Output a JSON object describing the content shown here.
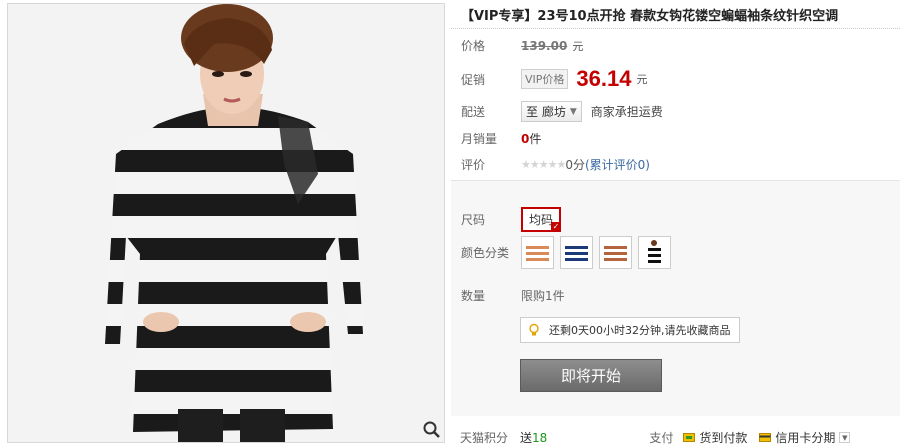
{
  "product": {
    "title": "【VIP专享】23号10点开抢 春款女钩花镂空蝙蝠袖条纹针织空调"
  },
  "price": {
    "label": "价格",
    "original": "139.00",
    "unit": "元"
  },
  "promo": {
    "label": "促销",
    "tag": "VIP价格",
    "price": "36.14",
    "unit": "元"
  },
  "shipping": {
    "label": "配送",
    "destination": "至 廊坊",
    "note": "商家承担运费"
  },
  "monthly_sales": {
    "label": "月销量",
    "count": "0",
    "unit": "件"
  },
  "rating": {
    "label": "评价",
    "stars": "★★★★★",
    "score": "0分",
    "reviews": "(累计评价0)"
  },
  "size": {
    "label": "尺码",
    "selected": "均码"
  },
  "color": {
    "label": "颜色分类",
    "swatches": [
      "orange-stripe",
      "navy-stripe",
      "brown-stripe",
      "black-white-stripe"
    ],
    "colors": [
      "#d98a57",
      "#1d3a78",
      "#b5653e",
      "#111111"
    ]
  },
  "quantity": {
    "label": "数量",
    "limit": "限购1件"
  },
  "notice": {
    "text": "还剩0天00小时32分钟,请先收藏商品"
  },
  "action": {
    "button": "即将开始"
  },
  "footer": {
    "points_label": "天猫积分",
    "points_prefix": "送",
    "points_value": "18",
    "pay_label": "支付",
    "cod": "货到付款",
    "credit": "信用卡分期"
  },
  "accent_color": "#c40000"
}
